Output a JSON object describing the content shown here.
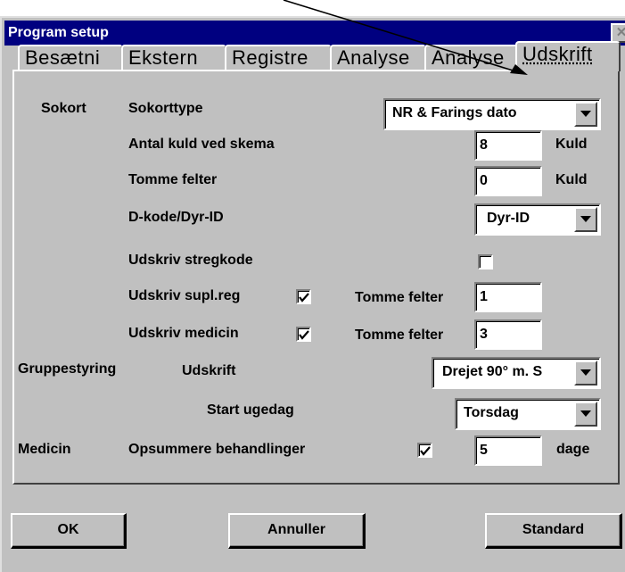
{
  "window": {
    "title": "Program setup",
    "close_glyph": "✕"
  },
  "tabs": [
    {
      "label": "Besætni"
    },
    {
      "label": "Ekstern"
    },
    {
      "label": "Registre"
    },
    {
      "label": "Analyse"
    },
    {
      "label": "Analyse"
    },
    {
      "label": "Udskrift",
      "active": true
    }
  ],
  "sokort": {
    "section_label": "Sokort",
    "type_label": "Sokorttype",
    "type_value": "NR & Farings dato",
    "antal_label": "Antal kuld ved skema",
    "antal_value": "8",
    "antal_unit": "Kuld",
    "tomme_label": "Tomme felter",
    "tomme_value": "0",
    "tomme_unit": "Kuld",
    "dkode_label": "D-kode/Dyr-ID",
    "dkode_value": "Dyr-ID",
    "stregkode_label": "Udskriv stregkode",
    "stregkode_checked": false,
    "suplreg_label": "Udskriv supl.reg",
    "suplreg_checked": true,
    "suplreg_tomme_label": "Tomme felter",
    "suplreg_tomme_value": "1",
    "medicin_label": "Udskriv medicin",
    "medicin_checked": true,
    "medicin_tomme_label": "Tomme felter",
    "medicin_tomme_value": "3"
  },
  "gruppestyring": {
    "section_label": "Gruppestyring",
    "udskrift_label": "Udskrift",
    "udskrift_value": "Drejet 90° m. S",
    "start_label": "Start ugedag",
    "start_value": "Torsdag"
  },
  "medicin": {
    "section_label": "Medicin",
    "opsummere_label": "Opsummere behandlinger",
    "opsummere_checked": true,
    "days_value": "5",
    "days_unit": "dage"
  },
  "buttons": {
    "ok": "OK",
    "annuller": "Annuller",
    "standard": "Standard"
  },
  "icons": {
    "combo": "chevron-down-icon",
    "check": "checkmark-icon",
    "pointer": "annotation-arrow"
  },
  "colors": {
    "titlebar": "#000080",
    "face": "#c0c0c0"
  }
}
